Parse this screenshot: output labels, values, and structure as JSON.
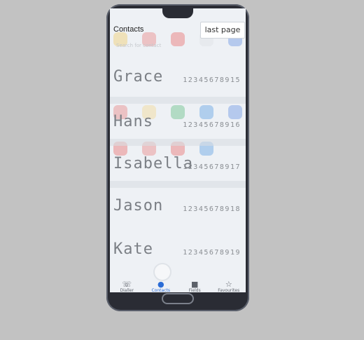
{
  "header": {
    "title": "Contacts",
    "last_page_label": "last page",
    "search_placeholder": "Search for contact"
  },
  "contacts": [
    {
      "name": "Grace",
      "number": "12345678915"
    },
    {
      "name": "Hans",
      "number": "12345678916"
    },
    {
      "name": "Isabella",
      "number": "12345678917"
    },
    {
      "name": "Jason",
      "number": "12345678918"
    },
    {
      "name": "Kate",
      "number": "12345678919"
    }
  ],
  "tabs": [
    {
      "label": "Dialler",
      "icon": "phone-icon"
    },
    {
      "label": "Contacts",
      "icon": "contacts-icon",
      "active": true
    },
    {
      "label": "Fields",
      "icon": "fields-icon"
    },
    {
      "label": "Favourites",
      "icon": "star-icon"
    }
  ],
  "colors": {
    "accent": "#2b6cd6",
    "background": "#c2c2c2",
    "phone_body": "#2a2c34"
  }
}
